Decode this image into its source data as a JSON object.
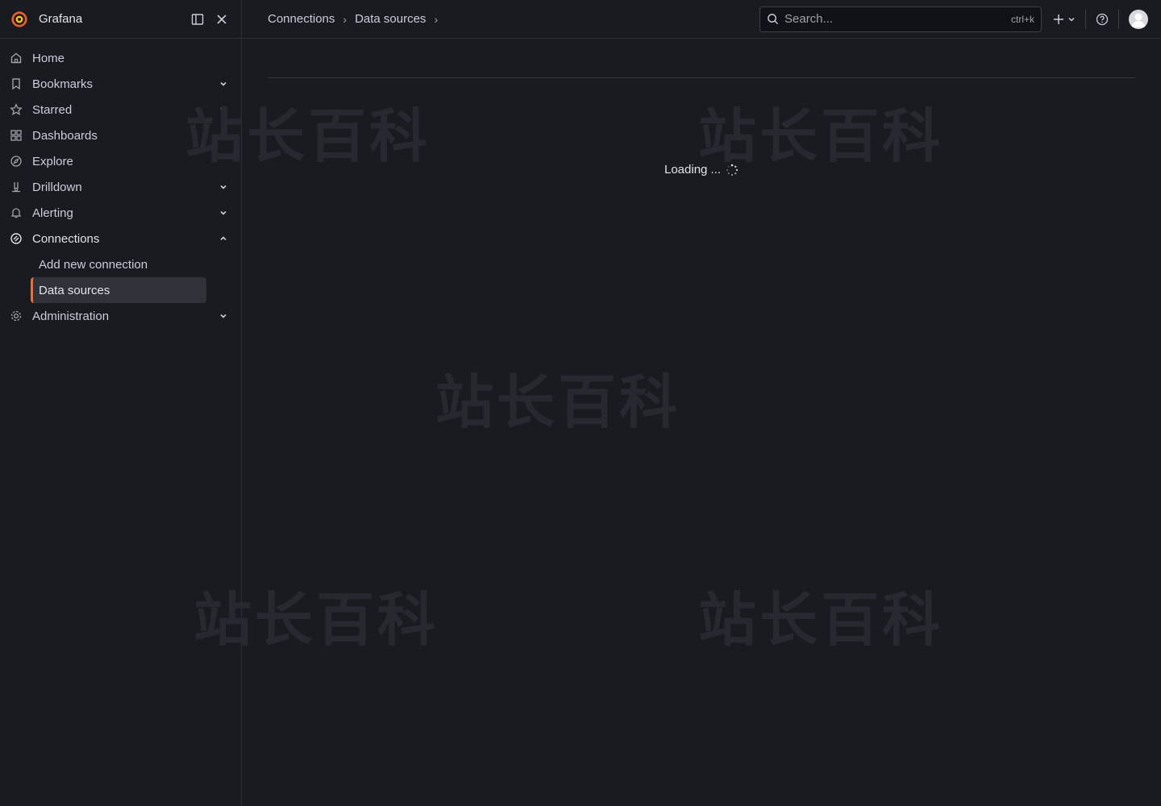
{
  "sidebar": {
    "brand": "Grafana",
    "items": [
      {
        "label": "Home"
      },
      {
        "label": "Bookmarks"
      },
      {
        "label": "Starred"
      },
      {
        "label": "Dashboards"
      },
      {
        "label": "Explore"
      },
      {
        "label": "Drilldown"
      },
      {
        "label": "Alerting"
      },
      {
        "label": "Connections"
      },
      {
        "label": "Administration"
      }
    ],
    "connections_sub": [
      {
        "label": "Add new connection"
      },
      {
        "label": "Data sources"
      }
    ]
  },
  "header": {
    "breadcrumb": [
      "Connections",
      "Data sources"
    ],
    "search_placeholder": "Search...",
    "search_shortcut": "ctrl+k"
  },
  "main": {
    "loading_text": "Loading ..."
  },
  "colors": {
    "accent": "#f26b3a",
    "background": "#181b1f"
  }
}
